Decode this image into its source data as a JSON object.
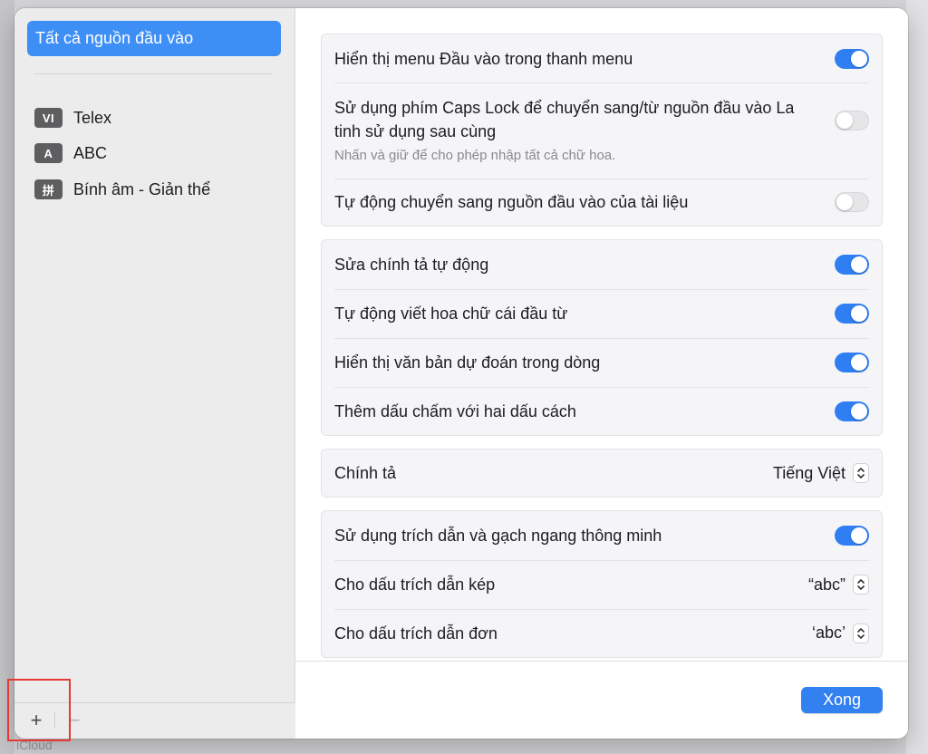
{
  "background": {
    "bottom_text": "iCloud"
  },
  "sidebar": {
    "all_sources_label": "Tất cả nguồn đầu vào",
    "items": [
      {
        "badge": "VI",
        "label": "Telex"
      },
      {
        "badge": "A",
        "label": "ABC"
      },
      {
        "badge": "拼",
        "label": "Bính âm - Giản thể"
      }
    ],
    "add_label": "+",
    "remove_label": "−"
  },
  "groups": {
    "input_menu": {
      "show_input_menu": {
        "label": "Hiển thị menu Đầu vào trong thanh menu",
        "on": true
      },
      "caps_lock": {
        "label": "Sử dụng phím Caps Lock để chuyển sang/từ nguồn đầu vào La tinh sử dụng sau cùng",
        "sub": "Nhấn và giữ để cho phép nhập tất cả chữ hoa.",
        "on": false
      },
      "auto_switch": {
        "label": "Tự động chuyển sang nguồn đầu vào của tài liệu",
        "on": false
      }
    },
    "text": {
      "autocorrect": {
        "label": "Sửa chính tả tự động",
        "on": true
      },
      "autocapitalize": {
        "label": "Tự động viết hoa chữ cái đầu từ",
        "on": true
      },
      "predictive": {
        "label": "Hiển thị văn bản dự đoán trong dòng",
        "on": true
      },
      "period": {
        "label": "Thêm dấu chấm với hai dấu cách",
        "on": true
      }
    },
    "spelling": {
      "label": "Chính tả",
      "value": "Tiếng Việt"
    },
    "quotes": {
      "smart": {
        "label": "Sử dụng trích dẫn và gạch ngang thông minh",
        "on": true
      },
      "double": {
        "label": "Cho dấu trích dẫn kép",
        "value": "“abc”"
      },
      "single": {
        "label": "Cho dấu trích dẫn đơn",
        "value": "‘abc’"
      }
    }
  },
  "footer": {
    "done_label": "Xong"
  },
  "colors": {
    "accent": "#3380f0",
    "sidebar_selected": "#3d8ff6",
    "highlight": "#e53935"
  }
}
